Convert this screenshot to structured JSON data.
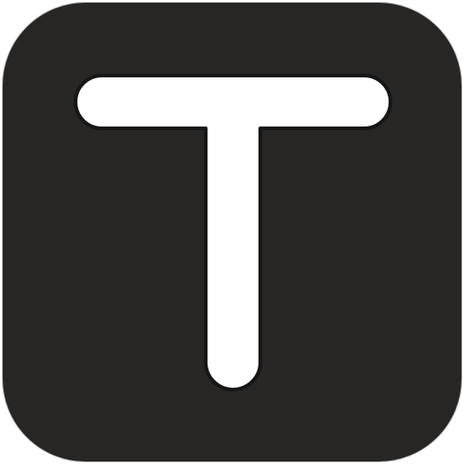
{
  "icon": {
    "name": "letter-t-app-icon",
    "background_color": "#272625",
    "glyph_color": "#ffffff",
    "glyph_outline_color": "#161616",
    "border_color": "#bdbdbd"
  }
}
